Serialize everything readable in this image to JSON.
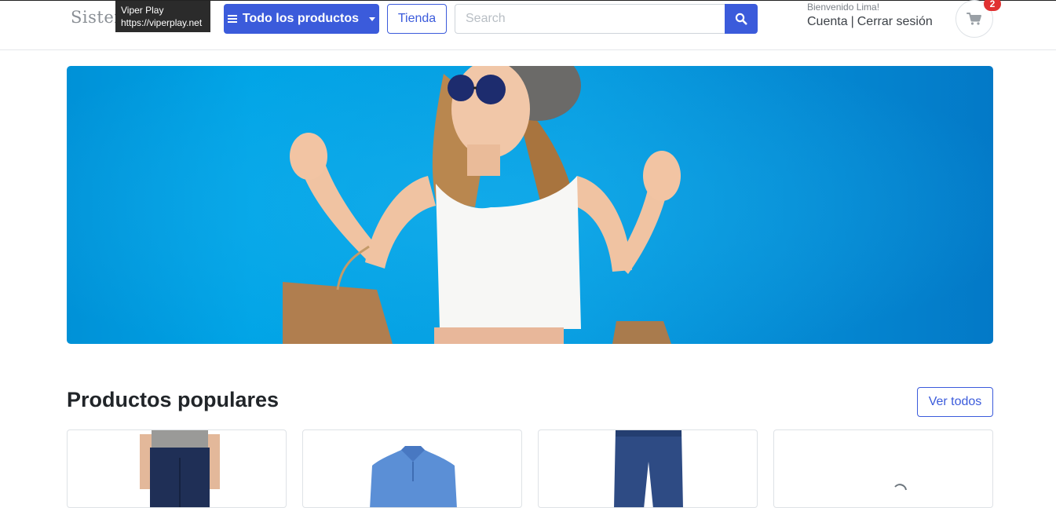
{
  "brand": {
    "name": "Sister"
  },
  "tooltip": {
    "title": "Viper Play",
    "url": "https://viperplay.net"
  },
  "nav": {
    "products_button": "Todo los productos",
    "store_button": "Tienda"
  },
  "search": {
    "placeholder": "Search",
    "value": ""
  },
  "account": {
    "welcome": "Bienvenido Lima!",
    "account_link": "Cuenta",
    "separator": "|",
    "logout_link": "Cerrar sesión"
  },
  "cart": {
    "count": "2"
  },
  "hero": {
    "image_description": "woman-with-shopping-bags"
  },
  "popular": {
    "title": "Productos populares",
    "view_all": "Ver todos",
    "products": [
      {
        "image": "jeans-model"
      },
      {
        "image": "blue-polo-shirt"
      },
      {
        "image": "denim-jeans"
      },
      {
        "image": "loading-placeholder"
      }
    ]
  },
  "colors": {
    "primary": "#3b5bdb",
    "badge": "#e03131",
    "hero_background": "#00a0e3"
  }
}
